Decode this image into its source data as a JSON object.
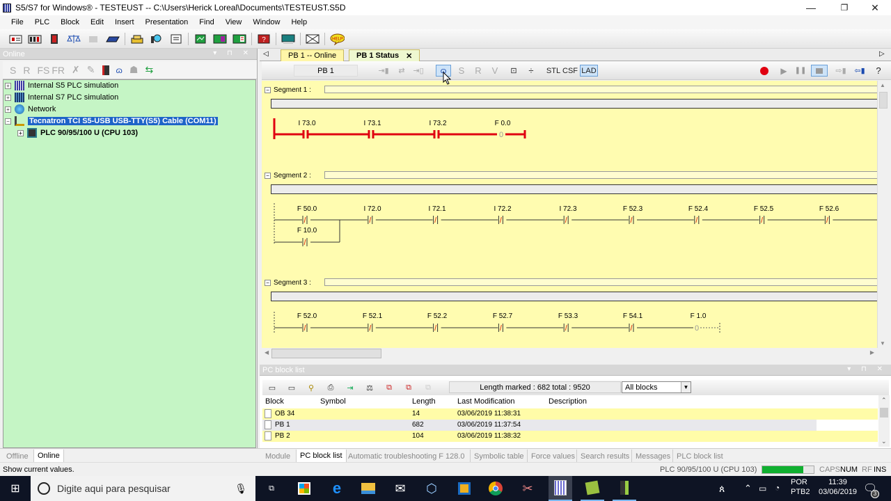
{
  "window": {
    "title": "S5/S7 for Windows® - TESTEUST -- C:\\Users\\Herick Loreal\\Documents\\TESTEUST.S5D",
    "minimize": "—",
    "restore": "❐",
    "close": "✕"
  },
  "menu": [
    "File",
    "PLC",
    "Block",
    "Edit",
    "Insert",
    "Presentation",
    "Find",
    "View",
    "Window",
    "Help"
  ],
  "main_toolbar": {
    "icons": [
      "new-block-icon",
      "open-block-icon",
      "plc-icon",
      "compare-icon",
      "disabled-icon",
      "module-icon",
      "transfer-icon",
      "network-search-icon",
      "print-preview-icon",
      "status-monitor-icon",
      "force-icon",
      "trend-icon",
      "diagnostics-icon",
      "terminal-icon",
      "mail-icon",
      "help-bubble-icon"
    ],
    "help_label": "HELP"
  },
  "online_panel": {
    "title": "Online",
    "toolbar": {
      "s": "S",
      "r": "R",
      "fs": "FS",
      "fr": "FR"
    },
    "tree": [
      {
        "label": "Internal S5 PLC simulation",
        "expander": "+",
        "icon": "s5-sim-icon"
      },
      {
        "label": "Internal S7 PLC simulation",
        "expander": "+",
        "icon": "s7-sim-icon"
      },
      {
        "label": "Network",
        "expander": "+",
        "icon": "network-icon"
      },
      {
        "label": "Tecnatron TCI S5-USB USB-TTY(S5) Cable (COM11)",
        "expander": "−",
        "icon": "cable-icon",
        "selected": true
      },
      {
        "label": "PLC 90/95/100 U (CPU 103)",
        "expander": "+",
        "icon": "plc-cpu-icon",
        "bold": true
      }
    ]
  },
  "editor": {
    "tabs": [
      {
        "label": "PB 1 -- Online",
        "active": false
      },
      {
        "label": "PB 1 Status",
        "active": true,
        "close": "✕"
      }
    ],
    "block_field": "PB 1",
    "toolbar": {
      "s": "S",
      "r": "R",
      "v": "V",
      "stl": "STL",
      "csf": "CSF",
      "lad": "LAD",
      "help": "?"
    },
    "segments": [
      {
        "label": "Segment 1 :",
        "expander": "−",
        "status_active": true,
        "contacts": [
          "I 73.0",
          "I 73.1",
          "I 73.2"
        ],
        "coil": "F 0.0",
        "coil_symbol": "0"
      },
      {
        "label": "Segment 2 :",
        "expander": "−",
        "status_active": false,
        "contacts": [
          "F 50.0",
          "I 72.0",
          "I 72.1",
          "I 72.2",
          "I 72.3",
          "F 52.3",
          "F 52.4",
          "F 52.5",
          "F 52.6"
        ],
        "parallel_contact": "F 10.0"
      },
      {
        "label": "Segment 3 :",
        "expander": "−",
        "status_active": false,
        "contacts": [
          "F 52.0",
          "F 52.1",
          "F 52.2",
          "F 52.7",
          "F 53.3",
          "F 54.1"
        ],
        "coil": "F 1.0",
        "coil_symbol": "0"
      }
    ]
  },
  "block_list": {
    "title": "PC block list",
    "length_info": "Length marked : 682  total : 9520",
    "filter": "All blocks",
    "columns": [
      "Block",
      "Symbol",
      "Length",
      "Last Modification",
      "Description"
    ],
    "rows": [
      {
        "block": "OB 34",
        "symbol": "",
        "length": "14",
        "modified": "03/06/2019 11:38:31",
        "description": ""
      },
      {
        "block": "PB 1",
        "symbol": "",
        "length": "682",
        "modified": "03/06/2019 11:37:54",
        "description": ""
      },
      {
        "block": "PB 2",
        "symbol": "",
        "length": "104",
        "modified": "03/06/2019 11:38:32",
        "description": ""
      }
    ]
  },
  "left_tabs": [
    {
      "label": "Offline",
      "active": false
    },
    {
      "label": "Online",
      "active": true
    }
  ],
  "bottom_tabs": [
    {
      "label": "Module",
      "active": false
    },
    {
      "label": "PC block list",
      "active": true
    },
    {
      "label": "Automatic troubleshooting F 128.0",
      "active": false
    },
    {
      "label": "Symbolic table",
      "active": false
    },
    {
      "label": "Force values",
      "active": false
    },
    {
      "label": "Search results",
      "active": false
    },
    {
      "label": "Messages",
      "active": false
    },
    {
      "label": "PLC block list",
      "active": false
    }
  ],
  "status_bar": {
    "message": "Show current values.",
    "plc": "PLC 90/95/100 U (CPU 103)",
    "connection_progress": 0.8,
    "caps": "CAPS",
    "num": "NUM",
    "rf": "RF",
    "ins": "INS"
  },
  "taskbar": {
    "search_placeholder": "Digite aqui para pesquisar",
    "lang_top": "POR",
    "lang_bottom": "PTB2",
    "time": "11:39",
    "date": "03/06/2019",
    "notifications": "3"
  }
}
